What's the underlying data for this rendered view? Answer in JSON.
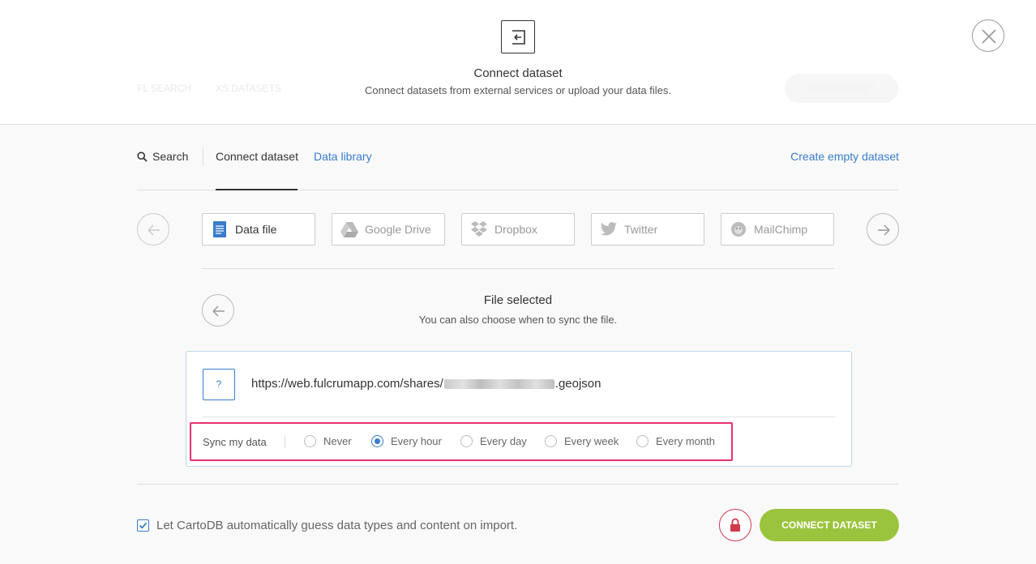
{
  "modal": {
    "title": "Connect dataset",
    "subtitle": "Connect datasets from external services or upload your data files."
  },
  "background": {
    "ghost_left_1": "FL SEARCH",
    "ghost_left_2": "XS DATASETS",
    "ghost_button": "NEW DATASET"
  },
  "tabs": {
    "search": "Search",
    "connect": "Connect dataset",
    "library": "Data library",
    "create_empty": "Create empty dataset"
  },
  "services": [
    {
      "label": "Data file",
      "icon": "document-icon",
      "active": true
    },
    {
      "label": "Google Drive",
      "icon": "google-drive-icon",
      "active": false
    },
    {
      "label": "Dropbox",
      "icon": "dropbox-icon",
      "active": false
    },
    {
      "label": "Twitter",
      "icon": "twitter-icon",
      "active": false
    },
    {
      "label": "MailChimp",
      "icon": "mailchimp-icon",
      "active": false
    }
  ],
  "file": {
    "title": "File selected",
    "subtitle": "You can also choose when to sync the file.",
    "type_badge": "?",
    "url_prefix": "https://web.fulcrumapp.com/shares/",
    "url_suffix": ".geojson"
  },
  "sync": {
    "label": "Sync my data",
    "options": [
      "Never",
      "Every hour",
      "Every day",
      "Every week",
      "Every month"
    ],
    "selected": "Every hour"
  },
  "footer": {
    "guess_label": "Let CartoDB automatically guess data types and content on import.",
    "guess_checked": true,
    "connect_label": "CONNECT DATASET"
  },
  "colors": {
    "accent_blue": "#397dcc",
    "connect_green": "#9bc43e",
    "highlight_pink": "#e8316e",
    "lock_red": "#d0384b"
  }
}
